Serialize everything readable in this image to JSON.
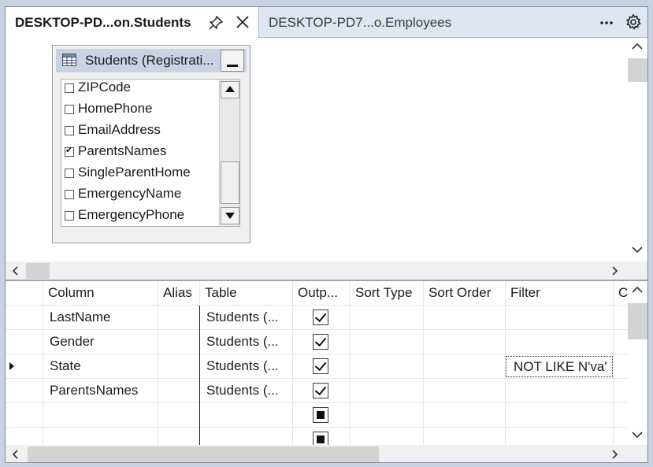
{
  "tabs": [
    {
      "label": "DESKTOP-PD...on.Students",
      "active": true
    },
    {
      "label": "DESKTOP-PD7...o.Employees",
      "active": false
    }
  ],
  "table_window": {
    "title": "Students (Registrati...",
    "columns": [
      {
        "name": "ZIPCode",
        "checked": false
      },
      {
        "name": "HomePhone",
        "checked": false
      },
      {
        "name": "EmailAddress",
        "checked": false
      },
      {
        "name": "ParentsNames",
        "checked": true
      },
      {
        "name": "SingleParentHome",
        "checked": false
      },
      {
        "name": "EmergencyName",
        "checked": false
      },
      {
        "name": "EmergencyPhone",
        "checked": false
      }
    ]
  },
  "grid": {
    "headers": [
      "Column",
      "Alias",
      "Table",
      "Outp...",
      "Sort Type",
      "Sort Order",
      "Filter",
      "C"
    ],
    "rows": [
      {
        "column": "LastName",
        "alias": "",
        "table": "Students (...",
        "output": "checked",
        "sort_type": "",
        "sort_order": "",
        "filter": "",
        "current": false
      },
      {
        "column": "Gender",
        "alias": "",
        "table": "Students (...",
        "output": "checked",
        "sort_type": "",
        "sort_order": "",
        "filter": "",
        "current": false
      },
      {
        "column": "State",
        "alias": "",
        "table": "Students (...",
        "output": "checked",
        "sort_type": "",
        "sort_order": "",
        "filter": "NOT LIKE N'va'",
        "current": true
      },
      {
        "column": "ParentsNames",
        "alias": "",
        "table": "Students (...",
        "output": "checked",
        "sort_type": "",
        "sort_order": "",
        "filter": "",
        "current": false
      },
      {
        "column": "",
        "alias": "",
        "table": "",
        "output": "indeterminate",
        "sort_type": "",
        "sort_order": "",
        "filter": "",
        "current": false
      },
      {
        "column": "",
        "alias": "",
        "table": "",
        "output": "indeterminate",
        "sort_type": "",
        "sort_order": "",
        "filter": "",
        "current": false
      }
    ]
  },
  "icons": {
    "pin": "pin-icon",
    "close": "close-icon",
    "more": "more-icon",
    "settings": "gear-icon",
    "table": "table-grid-icon"
  },
  "colors": {
    "tab_strip": "#dfe6f2",
    "title_bar": "#c9d3e3",
    "scroll_thumb": "#d3d3d3"
  }
}
